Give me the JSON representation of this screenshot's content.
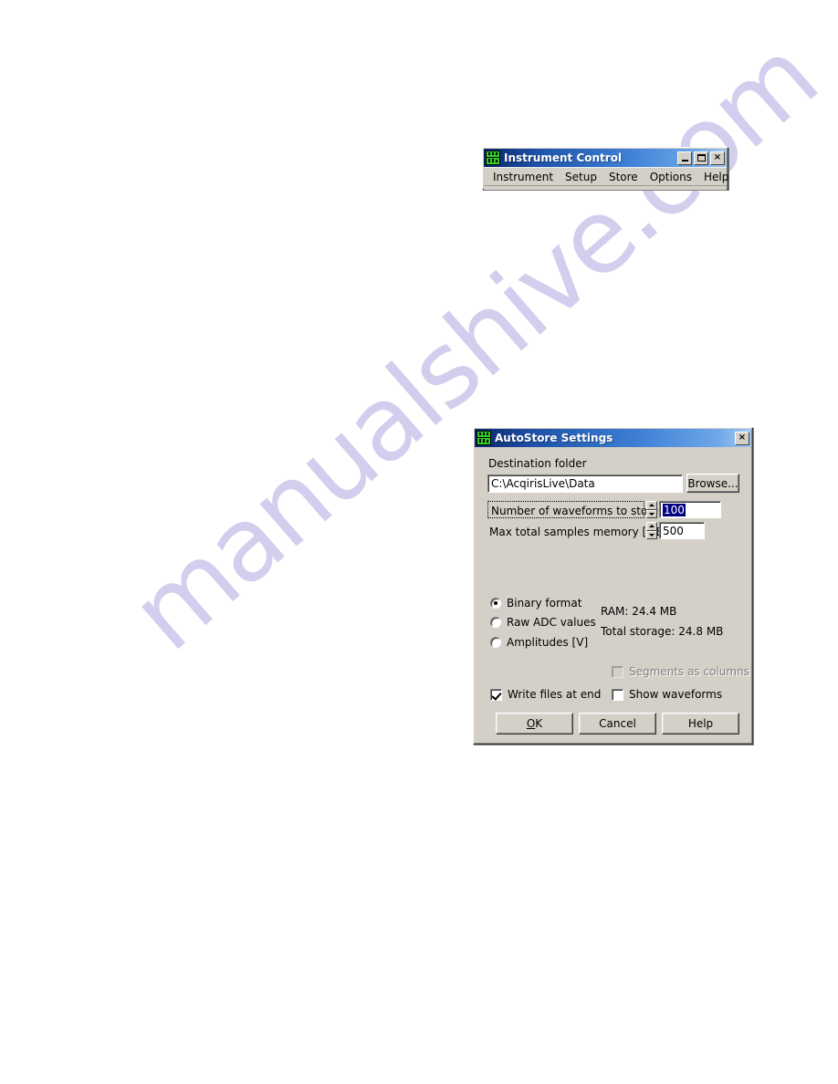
{
  "page": {
    "background_color": "#ffffff",
    "watermark_text": "manualshive.com",
    "watermark_color": "#c9c7ea"
  },
  "instrument_control": {
    "title": "Instrument Control",
    "icon": "acqiris-logo-icon",
    "window_buttons": {
      "minimize": "minimize-icon",
      "maximize": "maximize-icon",
      "close": "×"
    },
    "menu": [
      {
        "label": "Instrument"
      },
      {
        "label": "Setup"
      },
      {
        "label": "Store"
      },
      {
        "label": "Options"
      },
      {
        "label": "Help"
      }
    ]
  },
  "autostore": {
    "title": "AutoStore Settings",
    "icon": "acqiris-logo-icon",
    "close_label": "×",
    "destination": {
      "label": "Destination folder",
      "value": "C:\\AcqirisLive\\Data",
      "browse_label": "Browse..."
    },
    "fields": [
      {
        "label": "Number of waveforms to store",
        "value": "100",
        "selected": true
      },
      {
        "label": "Max total samples memory [MB]",
        "value": "500",
        "selected": false
      }
    ],
    "format_options": [
      {
        "label": "Binary format",
        "checked": true
      },
      {
        "label": "Raw ADC values",
        "checked": false
      },
      {
        "label": "Amplitudes [V]",
        "checked": false
      }
    ],
    "stats": {
      "ram": "RAM: 24.4 MB",
      "total_storage": "Total storage: 24.8 MB"
    },
    "checkboxes": [
      {
        "label": "Segments as columns",
        "checked": false,
        "disabled": true
      },
      {
        "label": "Show waveforms",
        "checked": false,
        "disabled": false
      },
      {
        "label": "Write files at end",
        "checked": true,
        "disabled": false
      }
    ],
    "buttons": {
      "ok": "OK",
      "ok_mnemonic": "O",
      "ok_rest": "K",
      "cancel": "Cancel",
      "help": "Help"
    },
    "colors": {
      "dialog_face": "#d4d0c8",
      "titlebar_start": "#0a246a",
      "titlebar_end": "#a5c9f0",
      "selection": "#000080"
    }
  }
}
